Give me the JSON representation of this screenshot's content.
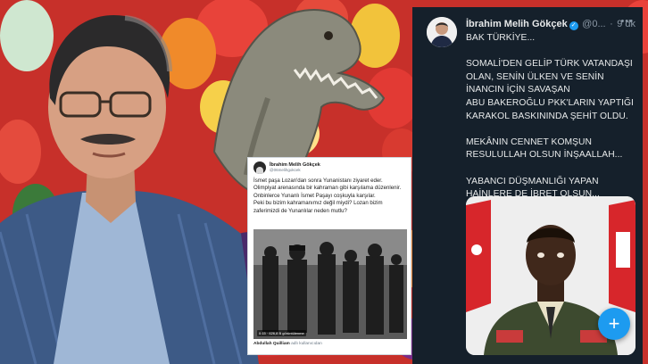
{
  "light_tweet": {
    "author_name": "İbrahim Melih Gökçek",
    "author_handle": "@06melihgokcek",
    "text": "İsmet paşa Lozan'dan sonra Yunanistanı ziyaret eder.\nOlimpiyat arenasında bir kahraman gibi karşılama düzenlenir. Onbinlerce Yunanlı İsmet Paşayı coşkuyla karşılar.\nPeki bu bizim kahramanımız değil miydi? Lozan bizim zaferimizdi de Yunanlılar neden mutlu?",
    "media_views": "0:15 · 626,8 B görüntülenme",
    "footer_name": "Abdullah Quilliam",
    "footer_suffix": "adlı kullanıcıdan"
  },
  "dark_tweet": {
    "author_name": "İbrahim Melih Gökçek",
    "verified_mark": "✓",
    "author_handle": "@0...",
    "separator": "·",
    "time": "9 dk",
    "more_icon": "more-options-icon",
    "text": "BAK TÜRKİYE...\n\nSOMALİ'DEN GELİP TÜRK VATANDAŞI OLAN, SENİN ÜLKEN VE SENİN İNANCIN İÇİN SAVAŞAN\nABU BAKEROĞLU PKK'LARIN YAPTIĞI KARAKOL BASKININDA ŞEHİT OLDU.\n\nMEKÂNIN CENNET KOMŞUN RESULULLAH OLSUN İNŞAALLAH...\n\nYABANCI DÜŞMANLIĞI YAPAN HAİNLERE DE İBRET OLSUN..."
  },
  "compose_button": {
    "label": "+"
  },
  "colors": {
    "dark_bg": "#15202b",
    "twitter_blue": "#1d9bf0",
    "dark_text": "#e7e9ea",
    "muted_text": "#8b98a5"
  }
}
